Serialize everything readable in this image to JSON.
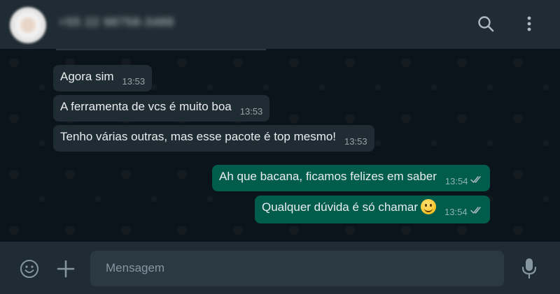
{
  "header": {
    "contact_name": "+55 22 98758-3488",
    "icons": [
      "search-icon",
      "more-vertical-icon"
    ]
  },
  "messages": [
    {
      "direction": "in",
      "text": "Agora sim",
      "time": "13:53"
    },
    {
      "direction": "in",
      "text": "A ferramenta de vcs é muito boa",
      "time": "13:53"
    },
    {
      "direction": "in",
      "text": "Tenho várias outras, mas esse pacote é top mesmo!",
      "time": "13:53"
    },
    {
      "direction": "out",
      "text": "Ah que bacana, ficamos felizes em saber",
      "time": "13:54",
      "status": "read"
    },
    {
      "direction": "out",
      "text": "Qualquer dúvida é só chamar",
      "time": "13:54",
      "status": "read",
      "emoji": "smiling-face"
    }
  ],
  "composer": {
    "placeholder": "Mensagem",
    "icons": [
      "emoji-icon",
      "plus-icon",
      "microphone-icon"
    ]
  },
  "colors": {
    "header_bg": "#1f2c33",
    "chat_bg": "#0b141a",
    "incoming_bubble": "#202c33",
    "outgoing_bubble": "#005c4b",
    "input_bg": "#2a3942",
    "text": "#e9edef"
  }
}
